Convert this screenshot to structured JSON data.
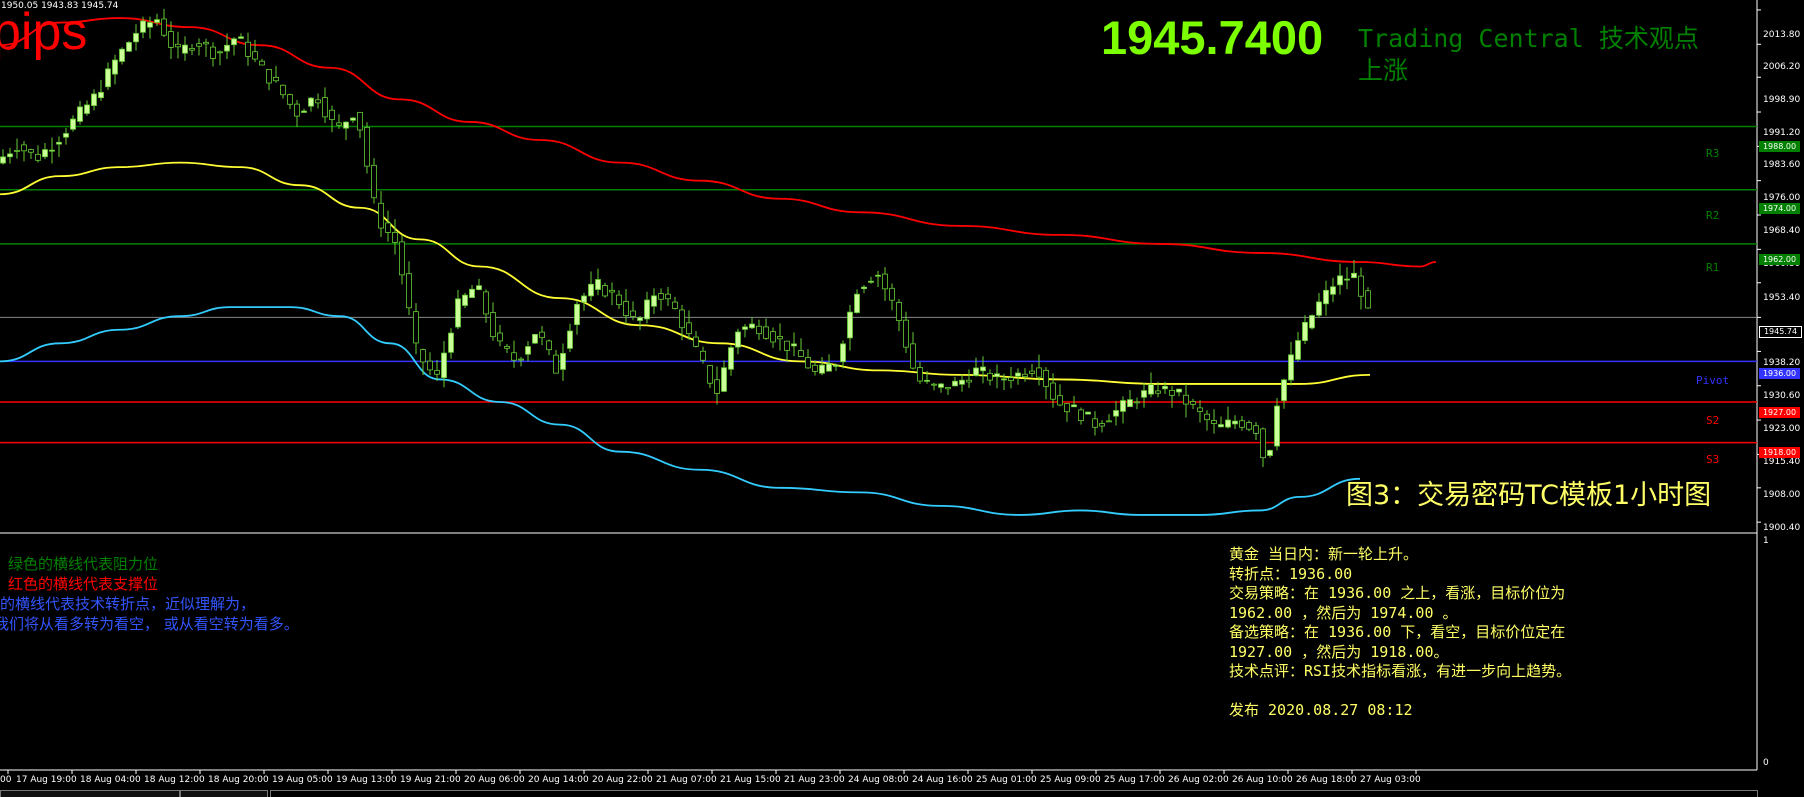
{
  "header": {
    "ohlc_text": "1950.05 1943.83 1945.74",
    "pips_text": "pips",
    "big_price": "1945.7400",
    "tc_title": "Trading Central 技术观点",
    "tc_trend": "上涨",
    "figure_caption": "图3：交易密码TC模板1小时图"
  },
  "colors": {
    "background": "#000000",
    "bull_candle": "#ccff99",
    "bear_candle": "#000000",
    "wick": "#66cc33",
    "resistance": "#008000",
    "support": "#ff0000",
    "pivot": "#3333ff",
    "ma_slow": "#ff0000",
    "ma_mid": "#ffff33",
    "ma_fast": "#33ccff",
    "text_yellow": "#ffff66",
    "big_price": "#7cff00"
  },
  "levels": [
    {
      "name": "R3",
      "label": "R3",
      "price": 1988.0,
      "price_text": "1988.00",
      "color": "#008000"
    },
    {
      "name": "R2",
      "label": "R2",
      "price": 1974.0,
      "price_text": "1974.00",
      "color": "#008000"
    },
    {
      "name": "R1",
      "label": "R1",
      "price": 1962.0,
      "price_text": "1962.00",
      "color": "#008000"
    },
    {
      "name": "pivot",
      "label": "Pivot",
      "price": 1936.0,
      "price_text": "1936.00",
      "color": "#3333ff"
    },
    {
      "name": "S2",
      "label": "S2",
      "price": 1927.0,
      "price_text": "1927.00",
      "color": "#ff0000"
    },
    {
      "name": "S3",
      "label": "S3",
      "price": 1918.0,
      "price_text": "1918.00",
      "color": "#ff0000"
    }
  ],
  "current_price": {
    "value": 1945.74,
    "text": "1945.74"
  },
  "price_axis": {
    "ticks": [
      "2013.80",
      "2006.20",
      "1998.90",
      "1991.20",
      "1983.60",
      "1976.00",
      "1968.40",
      "1960.80",
      "1953.40",
      "1945.74",
      "1938.20",
      "1930.60",
      "1923.00",
      "1915.40",
      "1908.00",
      "1900.40"
    ],
    "tick_values": [
      2013.8,
      2006.2,
      1998.9,
      1991.2,
      1983.6,
      1976.0,
      1968.4,
      1960.8,
      1953.4,
      1945.74,
      1938.2,
      1930.6,
      1923.0,
      1915.4,
      1908.0,
      1900.4
    ]
  },
  "indicator_axis": {
    "top": "1",
    "bottom": "0"
  },
  "time_axis": {
    "labels": [
      "17 Aug 19:00",
      "18 Aug 04:00",
      "18 Aug 12:00",
      "18 Aug 20:00",
      "19 Aug 05:00",
      "19 Aug 13:00",
      "19 Aug 21:00",
      "20 Aug 06:00",
      "20 Aug 14:00",
      "20 Aug 22:00",
      "21 Aug 07:00",
      "21 Aug 15:00",
      "21 Aug 23:00",
      "24 Aug 08:00",
      "24 Aug 16:00",
      "25 Aug 01:00",
      "25 Aug 09:00",
      "25 Aug 17:00",
      "26 Aug 02:00",
      "26 Aug 10:00",
      "26 Aug 18:00",
      "27 Aug 03:00"
    ],
    "leading_fragment": "00"
  },
  "legend": {
    "line1": "绿色的横线代表阻力位",
    "line2": "红色的横线代表支撑位",
    "line3": "的横线代表技术转折点，近似理解为，",
    "line4": "我们将从看多转为看空， 或从看空转为看多。"
  },
  "analysis": {
    "line1": "黄金 当日内：新一轮上升。",
    "line2": "转折点：1936.00",
    "line3": "交易策略：在 1936.00 之上，看涨，目标价位为",
    "line4": "1962.00 ，然后为 1974.00 。",
    "line5": "备选策略：在 1936.00 下，看空，目标价位定在",
    "line6": "1927.00 ，然后为 1918.00。",
    "line7": "技术点评：RSI技术指标看涨，有进一步向上趋势。",
    "line8": "发布 2020.08.27 08:12"
  }
}
